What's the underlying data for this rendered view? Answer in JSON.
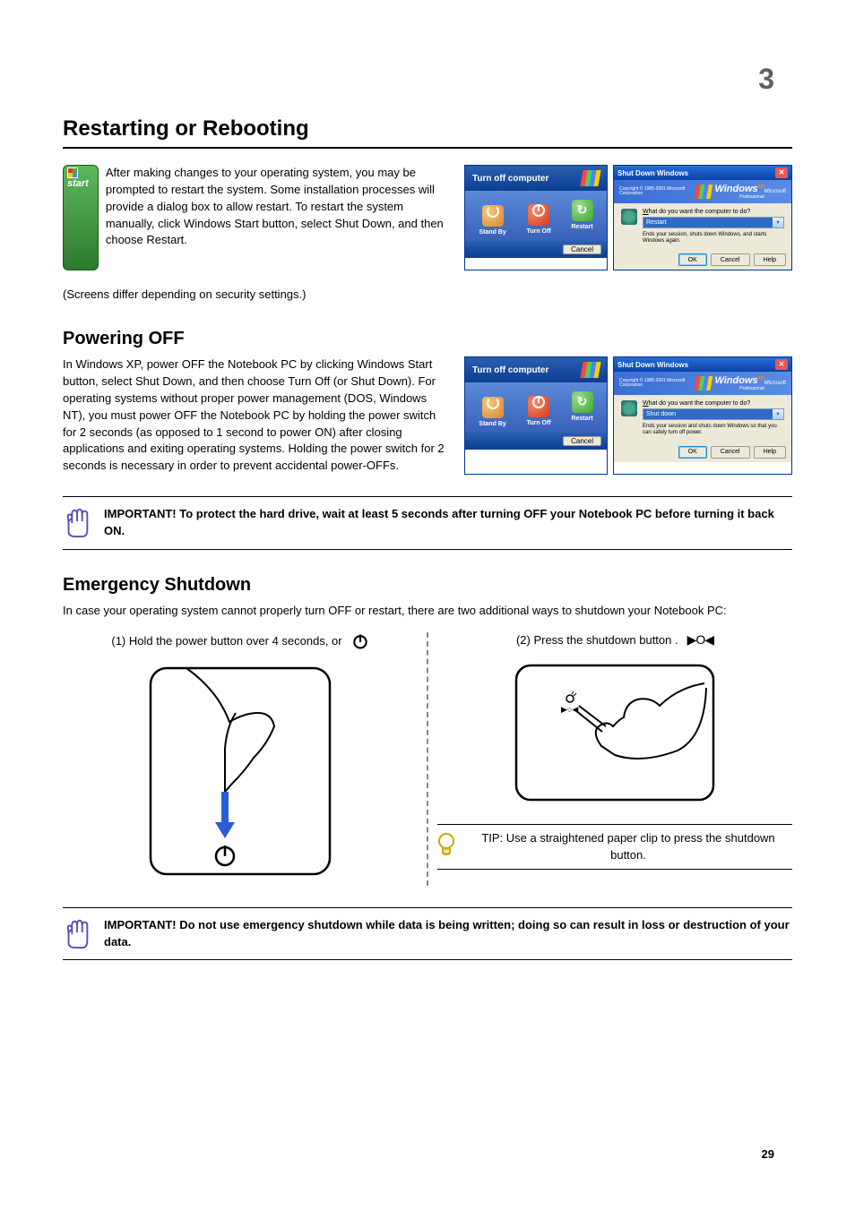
{
  "chapter": "3",
  "section_heading": "Restarting or Rebooting",
  "intro_paragraph": "After making changes to your operating system, you may be prompted to restart the system. Some installation processes will provide a dialog box to allow restart. To restart the system manually, click Windows Start button, select Shut Down, and then choose Restart.",
  "start_button_label": "start",
  "turn_off": {
    "title": "Turn off computer",
    "standby": "Stand By",
    "turn_off_label": "Turn Off",
    "restart": "Restart",
    "cancel": "Cancel"
  },
  "shutdown_dialog": {
    "title": "Shut Down Windows",
    "brand": "Windows",
    "xp": "xp",
    "professional": "Professional",
    "microsoft": "Microsoft",
    "copyright": "Copyright © 1985-2001\nMicrosoft Corporation",
    "prompt": "What do you want the computer to do?",
    "restart_option": "Restart",
    "restart_desc": "Ends your session, shuts down Windows, and starts Windows again.",
    "shutdown_option": "Shut down",
    "shutdown_desc": "Ends your session and shuts down Windows so that you can safely turn off power.",
    "ok": "OK",
    "cancel": "Cancel",
    "help": "Help"
  },
  "screen_caption": "(Screens differ depending on security settings.)",
  "power_off_heading": "Powering OFF",
  "power_off_paragraph": "In Windows XP, power OFF the Notebook PC by clicking Windows Start button, select Shut Down, and then choose Turn Off (or Shut Down). For operating systems without proper power management (DOS, Windows NT), you must power OFF the Notebook PC by holding the power switch for 2 seconds (as opposed to 1 second to power ON) after closing applications and exiting operating systems. Holding the power switch for 2 seconds is necessary in order to prevent accidental power-OFFs.",
  "important_power_off": "IMPORTANT! To protect the hard drive, wait at least 5 seconds after turning OFF your Notebook PC before turning it back ON.",
  "emergency_heading": "Emergency Shutdown",
  "emergency_paragraph": "In case your operating system cannot properly turn OFF or restart, there are two additional ways to shutdown your Notebook PC:",
  "method1": "(1) Hold the power button     over 4 seconds, or",
  "method2": "(2) Press the shutdown button      .",
  "tip_text": "TIP: Use a straightened paper clip to press the shutdown button.",
  "important_emergency": "IMPORTANT! Do not use emergency shutdown while data is being written; doing so can result in loss or destruction of your data.",
  "footer": "29"
}
